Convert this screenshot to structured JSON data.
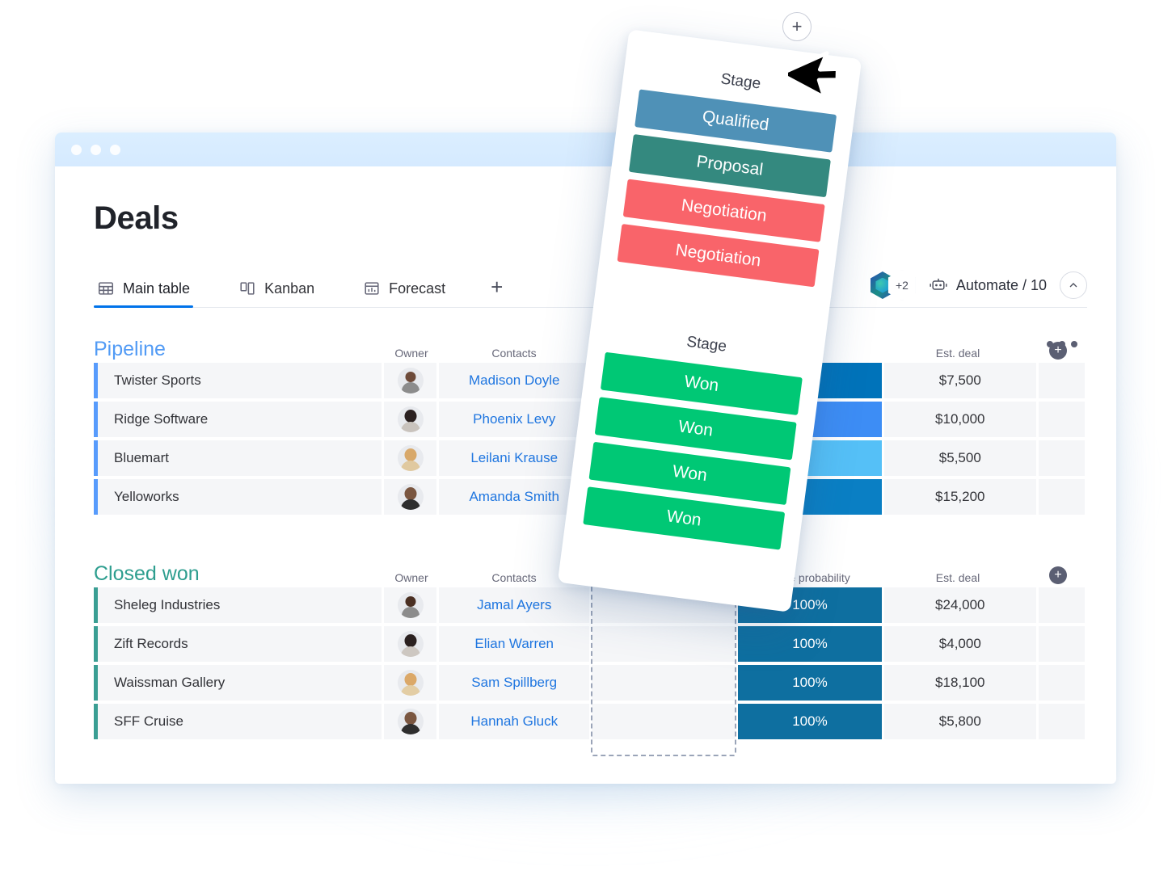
{
  "window": {
    "dots": 3
  },
  "header": {
    "title": "Deals",
    "kebab_label": "More options"
  },
  "tabs": [
    {
      "label": "Main table",
      "icon": "table-icon",
      "active": true
    },
    {
      "label": "Kanban",
      "icon": "kanban-icon",
      "active": false
    },
    {
      "label": "Forecast",
      "icon": "chart-icon",
      "active": false
    }
  ],
  "tab_add_label": "+",
  "toolbar": {
    "avatar_overflow": "+2",
    "automate_label": "Automate / 10",
    "collapse_label": "^"
  },
  "columns": {
    "owner": "Owner",
    "contacts": "Contacts",
    "stage": "Stage",
    "close_probability": "Close probability",
    "est_deal": "Est. deal",
    "add_column": "+"
  },
  "groups": [
    {
      "title": "Pipeline",
      "color": "#529bf5",
      "accent": "#579bfc",
      "rows": [
        {
          "name": "Twister Sports",
          "contact": "Madison Doyle",
          "probability_color": "#0073ba",
          "est_deal": "$7,500"
        },
        {
          "name": "Ridge Software",
          "contact": "Phoenix Levy",
          "probability_color": "#3d8df5",
          "est_deal": "$10,000"
        },
        {
          "name": "Bluemart",
          "contact": "Leilani Krause",
          "probability_color": "#55c0f7",
          "est_deal": "$5,500"
        },
        {
          "name": "Yelloworks",
          "contact": "Amanda Smith",
          "probability_color": "#0a7fc4",
          "est_deal": "$15,200"
        }
      ]
    },
    {
      "title": "Closed won",
      "color": "#2e9e8f",
      "accent": "#3a9e93",
      "rows": [
        {
          "name": "Sheleg Industries",
          "contact": "Jamal Ayers",
          "probability": "100%",
          "probability_color": "#0e6fa0",
          "est_deal": "$24,000"
        },
        {
          "name": "Zift Records",
          "contact": "Elian Warren",
          "probability": "100%",
          "probability_color": "#0e6fa0",
          "est_deal": "$4,000"
        },
        {
          "name": "Waissman Gallery",
          "contact": "Sam Spillberg",
          "probability": "100%",
          "probability_color": "#0e6fa0",
          "est_deal": "$18,100"
        },
        {
          "name": "SFF Cruise",
          "contact": "Hannah Gluck",
          "probability": "100%",
          "probability_color": "#0e6fa0",
          "est_deal": "$5,800"
        }
      ]
    }
  ],
  "drag_card": {
    "top_label": "Stage",
    "bottom_label": "Stage",
    "top_chips": [
      {
        "text": "Qualified",
        "color": "#4f91b7"
      },
      {
        "text": "Proposal",
        "color": "#34897f"
      },
      {
        "text": "Negotiation",
        "color": "#f9646a"
      },
      {
        "text": "Negotiation",
        "color": "#f9646a"
      }
    ],
    "bottom_chips": [
      {
        "text": "Won",
        "color": "#00c875"
      },
      {
        "text": "Won",
        "color": "#00c875"
      },
      {
        "text": "Won",
        "color": "#00c875"
      },
      {
        "text": "Won",
        "color": "#00c875"
      }
    ]
  },
  "add_button_label": "+"
}
